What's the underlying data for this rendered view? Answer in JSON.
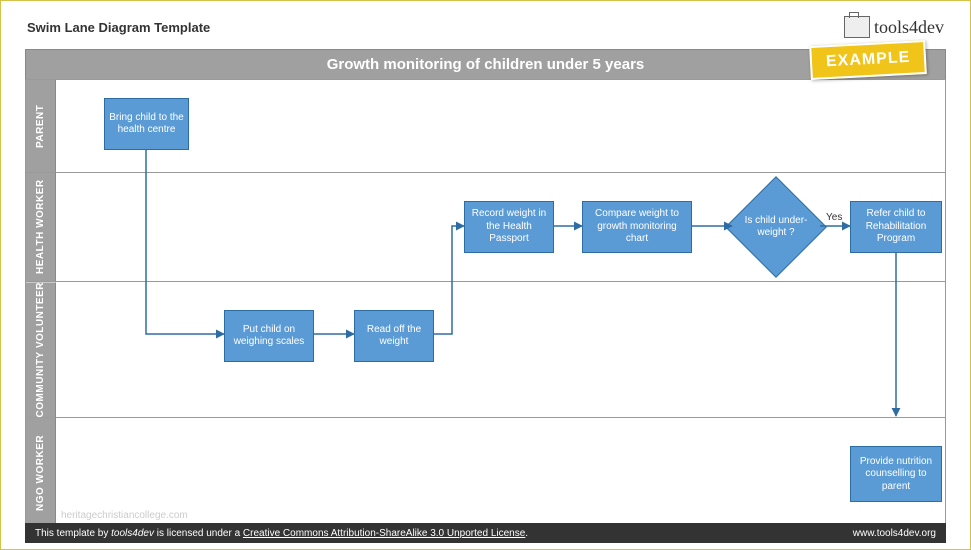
{
  "page_title": "Swim Lane Diagram Template",
  "logo_text": "tools4dev",
  "diagram_title": "Growth monitoring of children under 5 years",
  "example_tag": "EXAMPLE",
  "lanes": {
    "parent": "PARENT",
    "health": "HEALTH WORKER",
    "community": "COMMUNITY VOLUNTEER",
    "ngo": "NGO WORKER"
  },
  "nodes": {
    "bring_child": "Bring child to the health centre",
    "put_scales": "Put child on weighing scales",
    "read_weight": "Read off the weight",
    "record_weight": "Record weight in the Health Passport",
    "compare_weight": "Compare weight to growth monitoring chart",
    "decision": "Is child under-weight ?",
    "refer": "Refer child to Rehabilitation Program",
    "nutrition": "Provide nutrition counselling to parent"
  },
  "edge_labels": {
    "yes": "Yes"
  },
  "footer_license_prefix": "This template by ",
  "footer_license_brand": "tools4dev",
  "footer_license_mid": " is licensed under a ",
  "footer_license_link": "Creative Commons Attribution-ShareAlike 3.0 Unported License",
  "footer_license_suffix": ".",
  "footer_url": "www.tools4dev.org",
  "watermark": "heritagechristiancollege.com",
  "chart_data": {
    "type": "swimlane-flowchart",
    "title": "Growth monitoring of children under 5 years",
    "lanes": [
      "PARENT",
      "HEALTH WORKER",
      "COMMUNITY VOLUNTEER",
      "NGO WORKER"
    ],
    "nodes": [
      {
        "id": "bring_child",
        "lane": "PARENT",
        "type": "process",
        "label": "Bring child to the health centre"
      },
      {
        "id": "put_scales",
        "lane": "COMMUNITY VOLUNTEER",
        "type": "process",
        "label": "Put child on weighing scales"
      },
      {
        "id": "read_weight",
        "lane": "COMMUNITY VOLUNTEER",
        "type": "process",
        "label": "Read off the weight"
      },
      {
        "id": "record_weight",
        "lane": "HEALTH WORKER",
        "type": "process",
        "label": "Record weight in the Health Passport"
      },
      {
        "id": "compare_weight",
        "lane": "HEALTH WORKER",
        "type": "process",
        "label": "Compare weight to growth monitoring chart"
      },
      {
        "id": "decision",
        "lane": "HEALTH WORKER",
        "type": "decision",
        "label": "Is child under-weight?"
      },
      {
        "id": "refer",
        "lane": "HEALTH WORKER",
        "type": "process",
        "label": "Refer child to Rehabilitation Program"
      },
      {
        "id": "nutrition",
        "lane": "NGO WORKER",
        "type": "process",
        "label": "Provide nutrition counselling to parent"
      }
    ],
    "edges": [
      {
        "from": "bring_child",
        "to": "put_scales"
      },
      {
        "from": "put_scales",
        "to": "read_weight"
      },
      {
        "from": "read_weight",
        "to": "record_weight"
      },
      {
        "from": "record_weight",
        "to": "compare_weight"
      },
      {
        "from": "compare_weight",
        "to": "decision"
      },
      {
        "from": "decision",
        "to": "refer",
        "label": "Yes"
      },
      {
        "from": "refer",
        "to": "nutrition"
      }
    ]
  }
}
